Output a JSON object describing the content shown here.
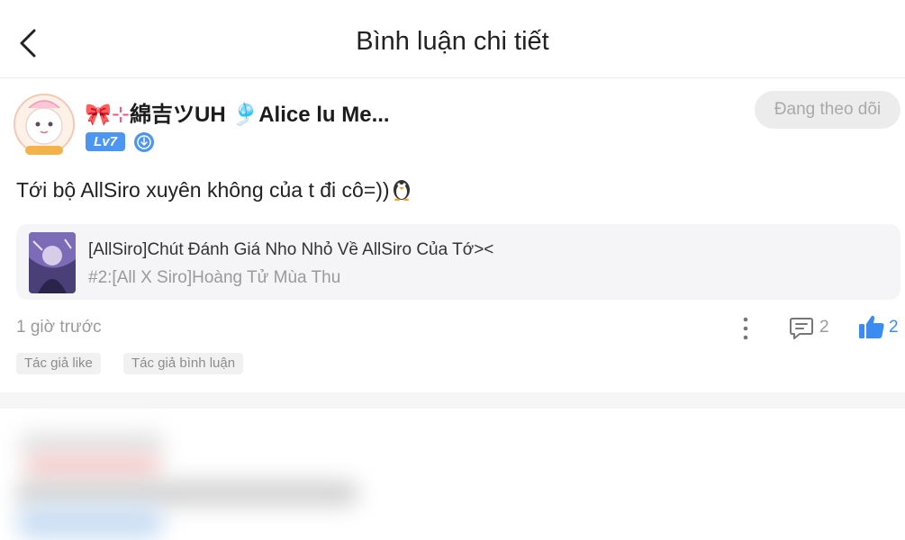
{
  "header": {
    "title": "Bình luận chi tiết"
  },
  "comment": {
    "username_prefix": "🎀⊹",
    "username": "綿吉ツUH 🎐Alice lu Me...",
    "level": "Lv7",
    "follow_label": "Đang theo dõi",
    "text": "Tới bộ AllSiro xuyên không của t đi cô=))",
    "reference": {
      "title": "[AllSiro]Chút Đánh Giá Nho Nhỏ Về AllSiro Của Tớ><",
      "subtitle": "#2:[All X Siro]Hoàng Tử Mùa Thu"
    },
    "time": "1 giờ trước",
    "comment_count": "2",
    "like_count": "2",
    "tags": [
      "Tác giả like",
      "Tác giả bình luận"
    ]
  },
  "colors": {
    "accent": "#3b8cf2",
    "level_badge": "#4c95f0",
    "follow_bg": "#ececec",
    "muted_text": "#9a9a9a"
  },
  "icons": [
    "back-chevron-icon",
    "verified-badge-icon",
    "more-vertical-icon",
    "comment-icon",
    "thumbs-up-icon",
    "penguin-emoji-icon"
  ]
}
